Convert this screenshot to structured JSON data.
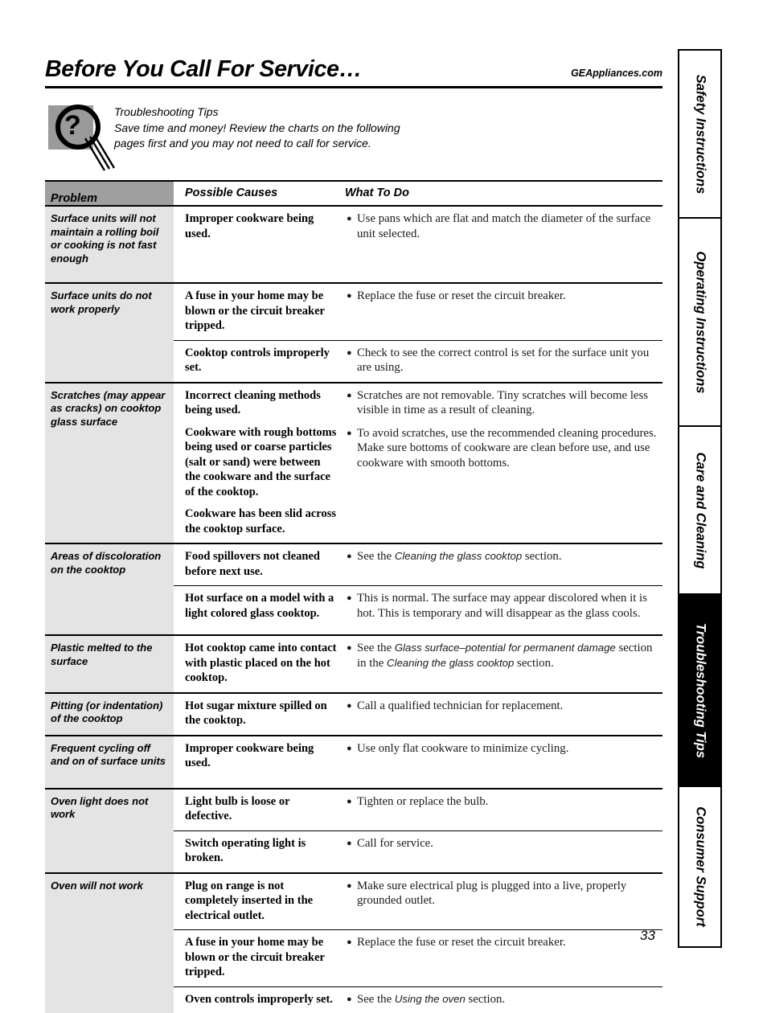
{
  "header": {
    "title": "Before You Call For Service…",
    "site_url": "GEAppliances.com"
  },
  "tip_banner": {
    "icon": "magnifier-question-icon",
    "heading": "Troubleshooting Tips",
    "line2": "Save time and money! Review the charts on the following",
    "line3": "pages first and you may not need to call for service."
  },
  "table": {
    "columns": {
      "problem": "Problem",
      "causes": "Possible Causes",
      "todo": "What To Do"
    },
    "groups": [
      {
        "problem": "Surface units will not maintain a rolling boil or cooking is not fast enough",
        "rows": [
          {
            "causes": [
              "Improper cookware being used."
            ],
            "todo": [
              {
                "pre": "Use pans which are flat and match the diameter of the surface unit selected.",
                "em": "",
                "post": ""
              }
            ]
          }
        ]
      },
      {
        "problem": "Surface units do not work properly",
        "rows": [
          {
            "causes": [
              "A fuse in your home may be blown or the circuit breaker tripped."
            ],
            "todo": [
              {
                "pre": "Replace the fuse or reset the circuit breaker.",
                "em": "",
                "post": ""
              }
            ]
          },
          {
            "causes": [
              "Cooktop controls improperly set."
            ],
            "todo": [
              {
                "pre": "Check to see the correct control is set for the surface unit you are using.",
                "em": "",
                "post": ""
              }
            ]
          }
        ]
      },
      {
        "problem": "Scratches (may appear as cracks) on cooktop glass surface",
        "rows": [
          {
            "causes": [
              "Incorrect cleaning methods being used.",
              "Cookware with rough bottoms being used or coarse particles (salt or sand) were between the cookware and the surface of the cooktop.",
              "Cookware has been slid across the cooktop surface."
            ],
            "todo": [
              {
                "pre": "Scratches are not removable. Tiny scratches will become less visible in time as a result of cleaning.",
                "em": "",
                "post": ""
              },
              {
                "pre": "To avoid scratches, use the recommended cleaning procedures. Make sure bottoms of cookware are clean before use, and use cookware with smooth bottoms.",
                "em": "",
                "post": ""
              }
            ]
          }
        ]
      },
      {
        "problem": "Areas of discoloration on the cooktop",
        "rows": [
          {
            "causes": [
              "Food spillovers not cleaned before next use."
            ],
            "todo": [
              {
                "pre": "See the ",
                "em": "Cleaning the glass cooktop",
                "post": " section."
              }
            ]
          },
          {
            "causes": [
              "Hot surface on a model with a light colored glass cooktop."
            ],
            "todo": [
              {
                "pre": "This is normal. The surface may appear discolored when it is hot. This is temporary and will disappear as the glass cools.",
                "em": "",
                "post": ""
              }
            ]
          }
        ]
      },
      {
        "problem": "Plastic melted to the surface",
        "rows": [
          {
            "causes": [
              "Hot cooktop came into contact with plastic placed on the hot cooktop."
            ],
            "todo": [
              {
                "pre": "See the ",
                "em": "Glass surface–potential for permanent damage",
                "post": " section in the ",
                "em2": "Cleaning the glass cooktop",
                "post2": " section."
              }
            ]
          }
        ]
      },
      {
        "problem": "Pitting (or indentation) of the cooktop",
        "rows": [
          {
            "causes": [
              "Hot sugar mixture spilled on the cooktop."
            ],
            "todo": [
              {
                "pre": "Call a qualified technician for replacement.",
                "em": "",
                "post": ""
              }
            ]
          }
        ]
      },
      {
        "problem": "Frequent cycling off and on of surface units",
        "rows": [
          {
            "causes": [
              "Improper cookware being used."
            ],
            "todo": [
              {
                "pre": "Use only flat cookware to minimize cycling.",
                "em": "",
                "post": ""
              }
            ]
          }
        ]
      },
      {
        "problem": "Oven light does not work",
        "rows": [
          {
            "causes": [
              "Light bulb is loose or defective."
            ],
            "todo": [
              {
                "pre": "Tighten or replace the bulb.",
                "em": "",
                "post": ""
              }
            ]
          },
          {
            "causes": [
              "Switch operating light is broken."
            ],
            "todo": [
              {
                "pre": "Call for service.",
                "em": "",
                "post": ""
              }
            ]
          }
        ]
      },
      {
        "problem": "Oven will not work",
        "rows": [
          {
            "causes": [
              "Plug on range is not completely inserted in the electrical outlet."
            ],
            "todo": [
              {
                "pre": "Make sure electrical plug is plugged into a live, properly grounded outlet.",
                "em": "",
                "post": ""
              }
            ]
          },
          {
            "causes": [
              "A fuse in your home may be blown or the circuit breaker tripped."
            ],
            "todo": [
              {
                "pre": "Replace the fuse or reset the circuit breaker.",
                "em": "",
                "post": ""
              }
            ]
          },
          {
            "causes": [
              "Oven controls improperly set."
            ],
            "todo": [
              {
                "pre": "See the ",
                "em": "Using the oven",
                "post": " section."
              }
            ]
          }
        ]
      }
    ]
  },
  "side_tabs": [
    {
      "label": "Safety Instructions",
      "active": false
    },
    {
      "label": "Operating Instructions",
      "active": false
    },
    {
      "label": "Care and Cleaning",
      "active": false
    },
    {
      "label": "Troubleshooting Tips",
      "active": true
    },
    {
      "label": "Consumer Support",
      "active": false
    }
  ],
  "footer": {
    "page_number": "33"
  },
  "colors": {
    "header_cell_gray": "#9f9f9f",
    "problem_cell_gray": "#e4e4e4",
    "active_tab_bg": "#000000",
    "rule": "#000000"
  }
}
